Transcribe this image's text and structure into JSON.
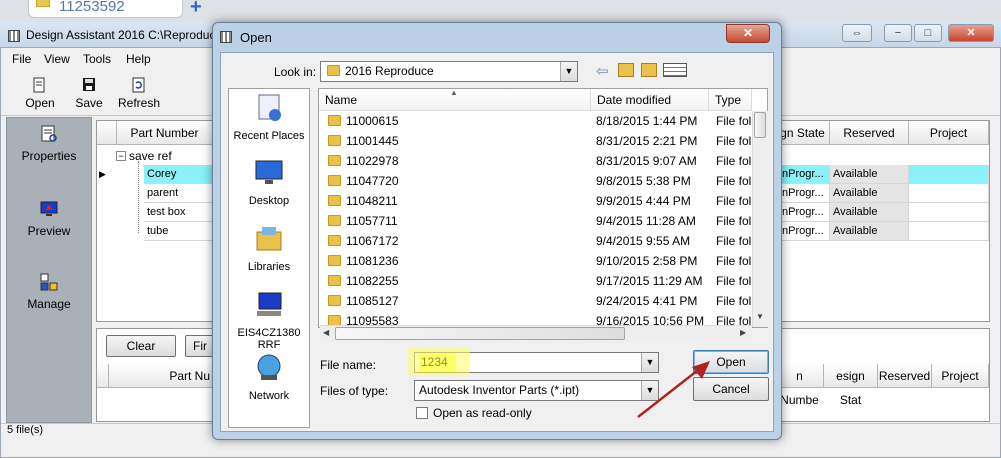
{
  "browser_tab": {
    "title": "11253592",
    "new_tab": "+"
  },
  "window": {
    "title": "Design Assistant 2016 C:\\Reproduc",
    "controls": {
      "restore": "⇔",
      "minimize": "−",
      "maximize": "□",
      "close": "✕"
    }
  },
  "menu": [
    "File",
    "View",
    "Tools",
    "Help"
  ],
  "toolbar": {
    "open": "Open",
    "save": "Save",
    "refresh": "Refresh"
  },
  "nav": {
    "properties": "Properties",
    "preview": "Preview",
    "manage": "Manage"
  },
  "grid": {
    "col_part_number": "Part Number",
    "col_design_state": "gn State",
    "col_reserved": "Reserved",
    "col_project": "Project",
    "root": "save ref",
    "expander": "−",
    "rows": [
      {
        "name": "Corey",
        "state": "InProgr...",
        "reserved": "Available"
      },
      {
        "name": "parent",
        "state": "InProgr...",
        "reserved": "Available"
      },
      {
        "name": "test box",
        "state": "InProgr...",
        "reserved": "Available"
      },
      {
        "name": "tube",
        "state": "InProgr...",
        "reserved": "Available"
      }
    ]
  },
  "lower": {
    "clear": "Clear",
    "find": "Fir",
    "col_part_number": "Part Nu",
    "col_num": "n Numbe",
    "col_design_state": "esign Stat",
    "col_reserved": "Reserved",
    "col_project": "Project"
  },
  "status": "5 file(s)",
  "dialog": {
    "title": "Open",
    "look_in_label": "Look in:",
    "look_in_value": "2016 Reproduce",
    "places": [
      "Recent Places",
      "Desktop",
      "Libraries",
      "EIS4CZ1380RRF",
      "Network"
    ],
    "columns": {
      "name": "Name",
      "date": "Date modified",
      "type": "Type"
    },
    "files": [
      {
        "name": "11000615",
        "date": "8/18/2015 1:44 PM",
        "type": "File fol"
      },
      {
        "name": "11001445",
        "date": "8/31/2015 2:21 PM",
        "type": "File fol"
      },
      {
        "name": "11022978",
        "date": "8/31/2015 9:07 AM",
        "type": "File fol"
      },
      {
        "name": "11047720",
        "date": "9/8/2015 5:38 PM",
        "type": "File fol"
      },
      {
        "name": "11048211",
        "date": "9/9/2015 4:44 PM",
        "type": "File fol"
      },
      {
        "name": "11057711",
        "date": "9/4/2015 11:28 AM",
        "type": "File fol"
      },
      {
        "name": "11067172",
        "date": "9/4/2015 9:55 AM",
        "type": "File fol"
      },
      {
        "name": "11081236",
        "date": "9/10/2015 2:58 PM",
        "type": "File fol"
      },
      {
        "name": "11082255",
        "date": "9/17/2015 11:29 AM",
        "type": "File fol"
      },
      {
        "name": "11085127",
        "date": "9/24/2015 4:41 PM",
        "type": "File fol"
      },
      {
        "name": "11095583",
        "date": "9/16/2015 10:56 PM",
        "type": "File fol"
      }
    ],
    "file_name_label": "File name:",
    "file_name_value": "1234",
    "files_of_type_label": "Files of type:",
    "files_of_type_value": "Autodesk Inventor Parts (*.ipt)",
    "read_only_label": "Open as read-only",
    "open_button": "Open",
    "cancel_button": "Cancel",
    "close_button": "✕"
  },
  "colors": {
    "highlight": "#ffff66",
    "selection": "#8bf0f8",
    "arrow": "#b22222"
  }
}
